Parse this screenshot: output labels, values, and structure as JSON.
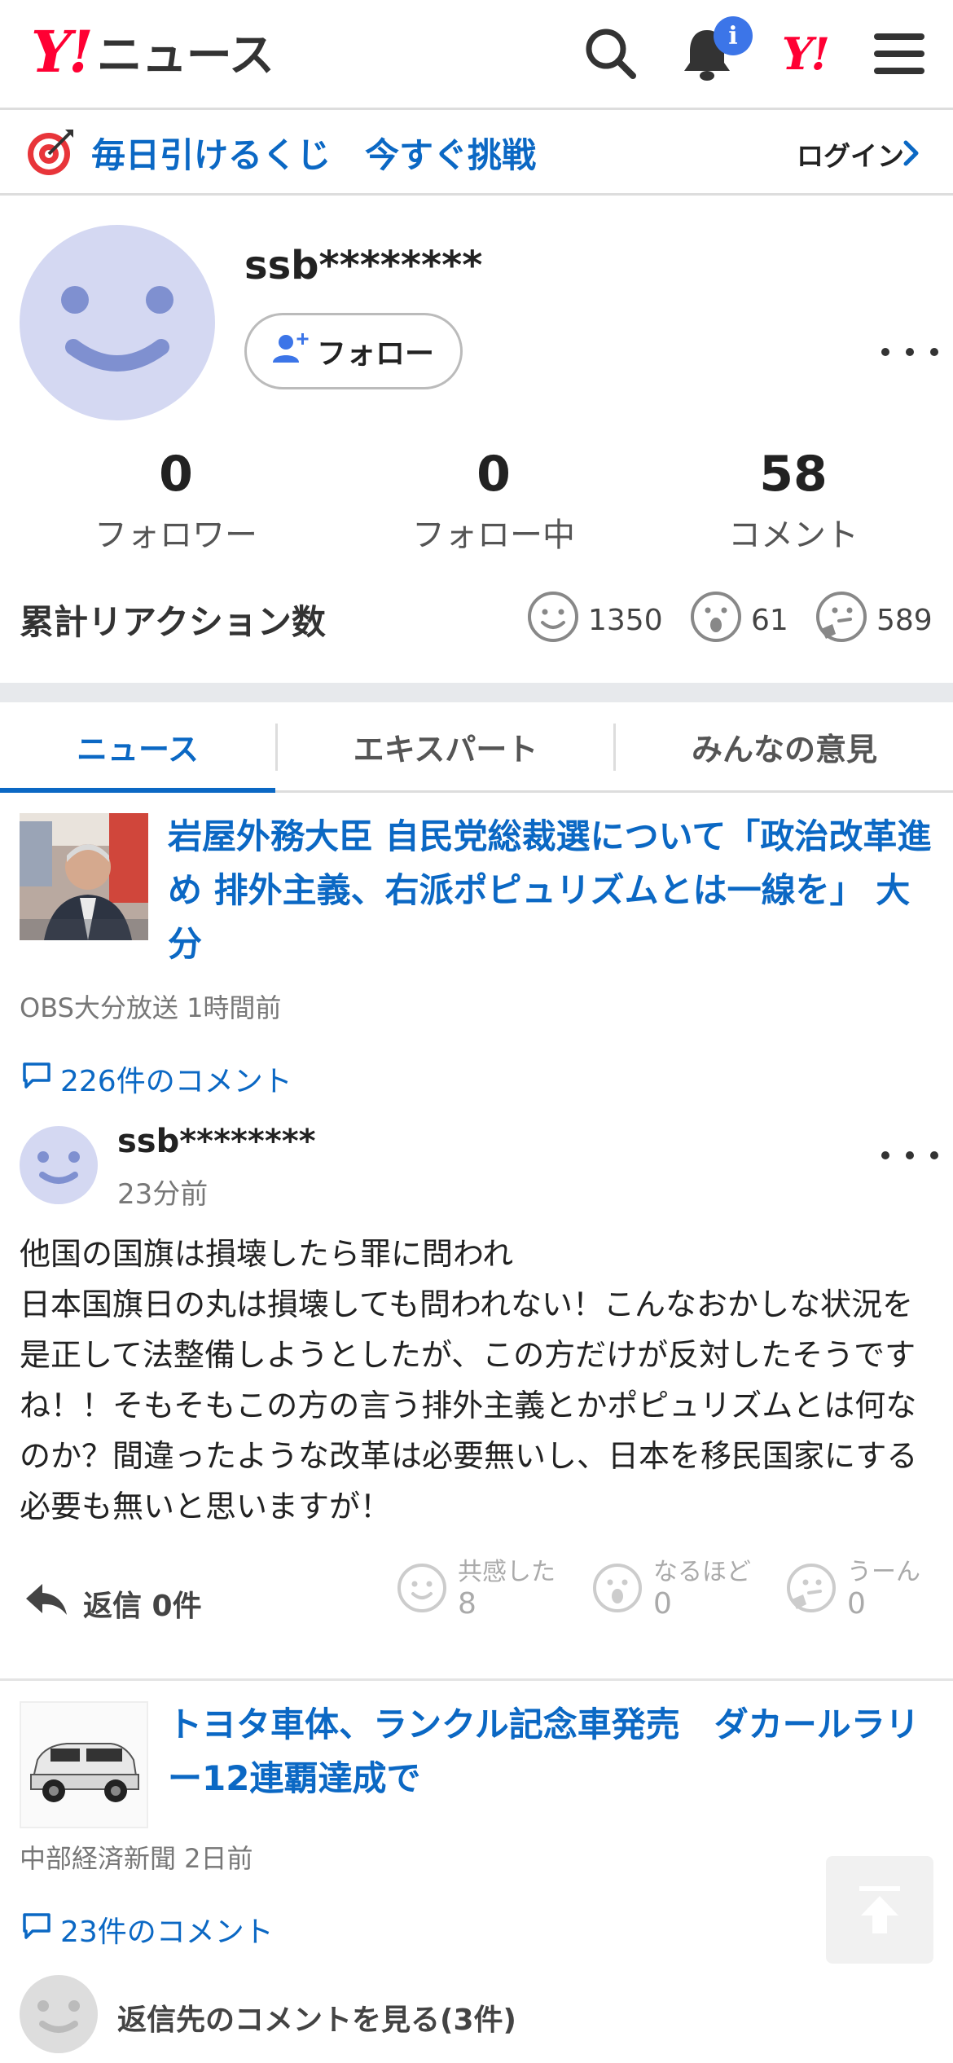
{
  "header": {
    "logo_y": "Y!",
    "logo_text": "ニュース",
    "notification_badge": "i",
    "yahoo_mark": "Y!",
    "icons": [
      "search-icon",
      "bell-icon",
      "yahoo-icon",
      "menu-icon"
    ]
  },
  "lottery": {
    "text": "毎日引けるくじ　今すぐ挑戦",
    "login": "ログイン"
  },
  "profile": {
    "username": "ssb********",
    "follow_label": "フォロー",
    "stats": [
      {
        "value": "0",
        "label": "フォロワー"
      },
      {
        "value": "0",
        "label": "フォロー中"
      },
      {
        "value": "58",
        "label": "コメント"
      }
    ],
    "reactions_title": "累計リアクション数",
    "reactions": [
      {
        "icon": "smile-icon",
        "count": "1350"
      },
      {
        "icon": "surprised-icon",
        "count": "61"
      },
      {
        "icon": "thinking-icon",
        "count": "589"
      }
    ]
  },
  "tabs": [
    "ニュース",
    "エキスパート",
    "みんなの意見"
  ],
  "articles": [
    {
      "title": "岩屋外務大臣 自民党総裁選について「政治改革進め 排外主義、右派ポピュリズムとは一線を」 大分",
      "source": "OBS大分放送 1時間前",
      "comments": "226件のコメント"
    },
    {
      "title": "トヨタ車体、ランクル記念車発売　ダカールラリー12連覇達成で",
      "source": "中部経済新聞 2日前",
      "comments": "23件のコメント"
    }
  ],
  "comment": {
    "username": "ssb********",
    "time": "23分前",
    "body": "他国の国旗は損壊したら罪に問われ\n日本国旗日の丸は損壊しても問われない！こんなおかしな状況を是正して法整備しようとしたが、この方だけが反対したそうですね！！そもそもこの方の言う排外主義とかポピュリズムとは何なのか？間違ったような改革は必要無いし、日本を移民国家にする必要も無いと思いますが！",
    "reply": "返信 0件",
    "reactions": [
      {
        "label": "共感した",
        "count": "8"
      },
      {
        "label": "なるほど",
        "count": "0"
      },
      {
        "label": "うーん",
        "count": "0"
      }
    ]
  },
  "see_replies": "返信先のコメントを見る(3件)",
  "colors": {
    "brand_red": "#ff0033",
    "link_blue": "#0b68c4",
    "badge_blue": "#3c75e8",
    "avatar": "#d4d8f2"
  }
}
